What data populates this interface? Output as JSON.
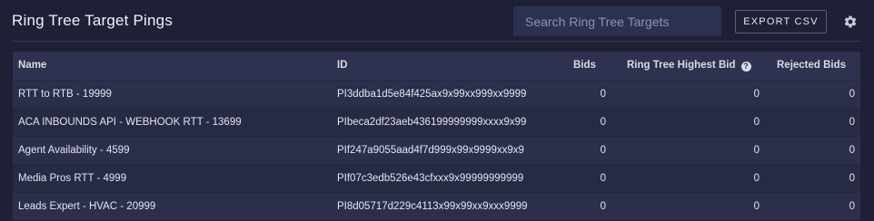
{
  "header": {
    "title": "Ring Tree Target Pings",
    "search_placeholder": "Search Ring Tree Targets",
    "export_label": "EXPORT CSV"
  },
  "table": {
    "columns": {
      "name": "Name",
      "id": "ID",
      "bids": "Bids",
      "highest_bid": "Ring Tree Highest Bid",
      "rejected": "Rejected Bids"
    },
    "rows": [
      {
        "name": "RTT to RTB - 19999",
        "id": "PI3ddba1d5e84f425ax9x99xx999xx9999",
        "bids": "0",
        "highest_bid": "0",
        "rejected": "0"
      },
      {
        "name": "ACA INBOUNDS API - WEBHOOK RTT - 13699",
        "id": "PIbeca2df23aeb436199999999xxxx9x99",
        "bids": "0",
        "highest_bid": "0",
        "rejected": "0"
      },
      {
        "name": "Agent Availability - 4599",
        "id": "PIf247a9055aad4f7d999x99x9999xx9x9",
        "bids": "0",
        "highest_bid": "0",
        "rejected": "0"
      },
      {
        "name": "Media Pros RTT - 4999",
        "id": "PIf07c3edb526e43cfxxx9x99999999999",
        "bids": "0",
        "highest_bid": "0",
        "rejected": "0"
      },
      {
        "name": "Leads Expert - HVAC - 20999",
        "id": "PI8d05717d229c4113x99x99xx9xxx9999",
        "bids": "0",
        "highest_bid": "0",
        "rejected": "0"
      }
    ]
  },
  "icons": {
    "settings": "gear-icon",
    "help": "question-circle-icon"
  }
}
